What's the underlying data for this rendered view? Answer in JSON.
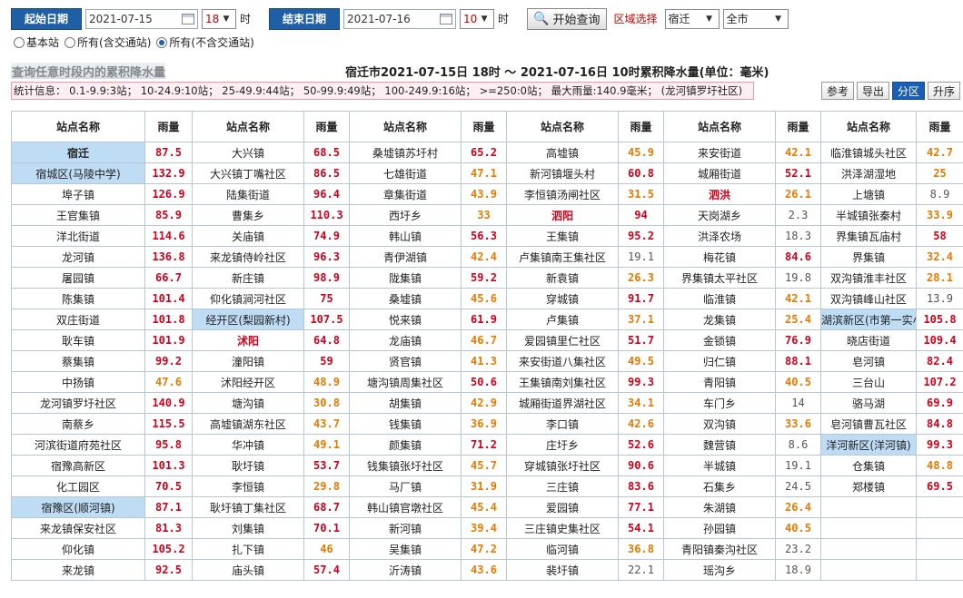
{
  "top": {
    "start_label": "起始日期",
    "start_date": "2021-07-15",
    "start_hour": "18",
    "hour_unit": "时",
    "end_label": "结束日期",
    "end_date": "2021-07-16",
    "end_hour": "10",
    "query_label": "开始查询",
    "region_label": "区域选择",
    "region_city": "宿迁",
    "region_area": "全市"
  },
  "radios": [
    {
      "label": "基本站",
      "checked": false
    },
    {
      "label": "所有(含交通站)",
      "checked": false
    },
    {
      "label": "所有(不含交通站)",
      "checked": true
    }
  ],
  "subtitle": "查询任意时段内的累积降水量",
  "title": "宿迁市2021-07-15日 18时 ～ 2021-07-16日 10时累积降水量(单位：毫米)",
  "stats": "统计信息： 0.1-9.9:3站； 10-24.9:10站； 25-49.9:44站； 50-99.9:49站； 100-249.9:16站； >=250:0站； 最大雨量:140.9毫米； (龙河镇罗圩社区)",
  "tools": [
    {
      "label": "参考",
      "active": false
    },
    {
      "label": "导出",
      "active": false
    },
    {
      "label": "分区",
      "active": true
    },
    {
      "label": "升序",
      "active": false
    }
  ],
  "headers": {
    "name": "站点名称",
    "rain": "雨量"
  },
  "colors": {
    "c1": "#555555",
    "c2": "#e87a00",
    "c3": "#d0021b",
    "highlight": "#bfdcf5"
  },
  "table": [
    [
      [
        "宿迁",
        "87.5",
        "hc"
      ],
      [
        "大兴镇",
        "68.5"
      ],
      [
        "桑墟镇苏圩村",
        "65.2"
      ],
      [
        "高墟镇",
        "45.9"
      ],
      [
        "来安街道",
        "42.1"
      ],
      [
        "临淮镇城头社区",
        "42.7"
      ]
    ],
    [
      [
        "宿城区(马陵中学)",
        "132.9",
        "h"
      ],
      [
        "大兴镇丁嘴社区",
        "86.5"
      ],
      [
        "七雄街道",
        "47.1"
      ],
      [
        "新河镇堰头村",
        "60.8"
      ],
      [
        "城厢街道",
        "52.1"
      ],
      [
        "洪泽湖湿地",
        "25"
      ]
    ],
    [
      [
        "埠子镇",
        "126.9"
      ],
      [
        "陆集街道",
        "96.4"
      ],
      [
        "章集街道",
        "43.9"
      ],
      [
        "李恒镇汤闸社区",
        "31.5"
      ],
      [
        "泗洪",
        "26.1",
        "cr"
      ],
      [
        "上塘镇",
        "8.9"
      ]
    ],
    [
      [
        "王官集镇",
        "85.9"
      ],
      [
        "曹集乡",
        "110.3"
      ],
      [
        "西圩乡",
        "33"
      ],
      [
        "泗阳",
        "94",
        "cr"
      ],
      [
        "天岗湖乡",
        "2.3"
      ],
      [
        "半城镇张秦村",
        "33.9"
      ]
    ],
    [
      [
        "洋北街道",
        "114.6"
      ],
      [
        "关庙镇",
        "74.9"
      ],
      [
        "韩山镇",
        "56.3"
      ],
      [
        "王集镇",
        "95.2"
      ],
      [
        "洪泽农场",
        "18.3"
      ],
      [
        "界集镇瓦庙村",
        "58"
      ]
    ],
    [
      [
        "龙河镇",
        "136.8"
      ],
      [
        "来龙镇侍岭社区",
        "96.3"
      ],
      [
        "青伊湖镇",
        "42.4"
      ],
      [
        "卢集镇南王集社区",
        "19.1"
      ],
      [
        "梅花镇",
        "84.6"
      ],
      [
        "界集镇",
        "32.4"
      ]
    ],
    [
      [
        "屠园镇",
        "66.7"
      ],
      [
        "新庄镇",
        "98.9"
      ],
      [
        "陇集镇",
        "59.2"
      ],
      [
        "新袁镇",
        "26.3"
      ],
      [
        "界集镇太平社区",
        "19.8"
      ],
      [
        "双沟镇淮丰社区",
        "28.1"
      ]
    ],
    [
      [
        "陈集镇",
        "101.4"
      ],
      [
        "仰化镇涧河社区",
        "75"
      ],
      [
        "桑墟镇",
        "45.6"
      ],
      [
        "穿城镇",
        "91.7"
      ],
      [
        "临淮镇",
        "42.1"
      ],
      [
        "双沟镇峰山社区",
        "13.9"
      ]
    ],
    [
      [
        "双庄街道",
        "101.8"
      ],
      [
        "经开区(梨园新村)",
        "107.5",
        "h"
      ],
      [
        "悦来镇",
        "61.9"
      ],
      [
        "卢集镇",
        "37.1"
      ],
      [
        "龙集镇",
        "25.4"
      ],
      [
        "湖滨新区(市第一实小)",
        "105.8",
        "h"
      ]
    ],
    [
      [
        "耿车镇",
        "101.9"
      ],
      [
        "沭阳",
        "64.8",
        "cr"
      ],
      [
        "龙庙镇",
        "46.7"
      ],
      [
        "爱园镇里仁社区",
        "51.7"
      ],
      [
        "金锁镇",
        "76.9"
      ],
      [
        "晓店街道",
        "109.4"
      ]
    ],
    [
      [
        "蔡集镇",
        "99.2"
      ],
      [
        "潼阳镇",
        "59"
      ],
      [
        "贤官镇",
        "41.3"
      ],
      [
        "来安街道八集社区",
        "49.5"
      ],
      [
        "归仁镇",
        "88.1"
      ],
      [
        "皂河镇",
        "82.4"
      ]
    ],
    [
      [
        "中扬镇",
        "47.6"
      ],
      [
        "沭阳经开区",
        "48.9"
      ],
      [
        "塘沟镇周集社区",
        "50.6"
      ],
      [
        "王集镇南刘集社区",
        "99.3"
      ],
      [
        "青阳镇",
        "40.5"
      ],
      [
        "三台山",
        "107.2"
      ]
    ],
    [
      [
        "龙河镇罗圩社区",
        "140.9"
      ],
      [
        "塘沟镇",
        "30.8"
      ],
      [
        "胡集镇",
        "42.9"
      ],
      [
        "城厢街道界湖社区",
        "34.1"
      ],
      [
        "车门乡",
        "14"
      ],
      [
        "骆马湖",
        "69.9"
      ]
    ],
    [
      [
        "南蔡乡",
        "115.5"
      ],
      [
        "高墟镇湖东社区",
        "43.7"
      ],
      [
        "钱集镇",
        "36.9"
      ],
      [
        "李口镇",
        "42.6"
      ],
      [
        "双沟镇",
        "33.6"
      ],
      [
        "皂河镇曹瓦社区",
        "84.8"
      ]
    ],
    [
      [
        "河滨街道府苑社区",
        "95.8"
      ],
      [
        "华冲镇",
        "49.1"
      ],
      [
        "颜集镇",
        "71.2"
      ],
      [
        "庄圩乡",
        "52.6"
      ],
      [
        "魏营镇",
        "8.6"
      ],
      [
        "洋河新区(洋河镇)",
        "99.3",
        "h"
      ]
    ],
    [
      [
        "宿豫高新区",
        "101.3"
      ],
      [
        "耿圩镇",
        "53.7"
      ],
      [
        "钱集镇张圩社区",
        "45.7"
      ],
      [
        "穿城镇张圩社区",
        "90.6"
      ],
      [
        "半城镇",
        "19.1"
      ],
      [
        "仓集镇",
        "48.8"
      ]
    ],
    [
      [
        "化工园区",
        "70.5"
      ],
      [
        "李恒镇",
        "29.8"
      ],
      [
        "马厂镇",
        "31.9"
      ],
      [
        "三庄镇",
        "83.6"
      ],
      [
        "石集乡",
        "24.5"
      ],
      [
        "郑楼镇",
        "69.5"
      ]
    ],
    [
      [
        "宿豫区(顺河镇)",
        "87.1",
        "h"
      ],
      [
        "耿圩镇丁集社区",
        "68.7"
      ],
      [
        "韩山镇官墩社区",
        "45.4"
      ],
      [
        "爱园镇",
        "77.1"
      ],
      [
        "朱湖镇",
        "26.4"
      ],
      [
        "",
        ""
      ]
    ],
    [
      [
        "来龙镇保安社区",
        "81.3"
      ],
      [
        "刘集镇",
        "70.1"
      ],
      [
        "新河镇",
        "39.4"
      ],
      [
        "三庄镇史集社区",
        "54.1"
      ],
      [
        "孙园镇",
        "40.5"
      ],
      [
        "",
        ""
      ]
    ],
    [
      [
        "仰化镇",
        "105.2"
      ],
      [
        "扎下镇",
        "46"
      ],
      [
        "吴集镇",
        "47.2"
      ],
      [
        "临河镇",
        "36.8"
      ],
      [
        "青阳镇秦沟社区",
        "23.2"
      ],
      [
        "",
        ""
      ]
    ],
    [
      [
        "来龙镇",
        "92.5"
      ],
      [
        "庙头镇",
        "57.4"
      ],
      [
        "沂涛镇",
        "43.6"
      ],
      [
        "裴圩镇",
        "22.1"
      ],
      [
        "瑶沟乡",
        "18.9"
      ],
      [
        "",
        ""
      ]
    ]
  ]
}
